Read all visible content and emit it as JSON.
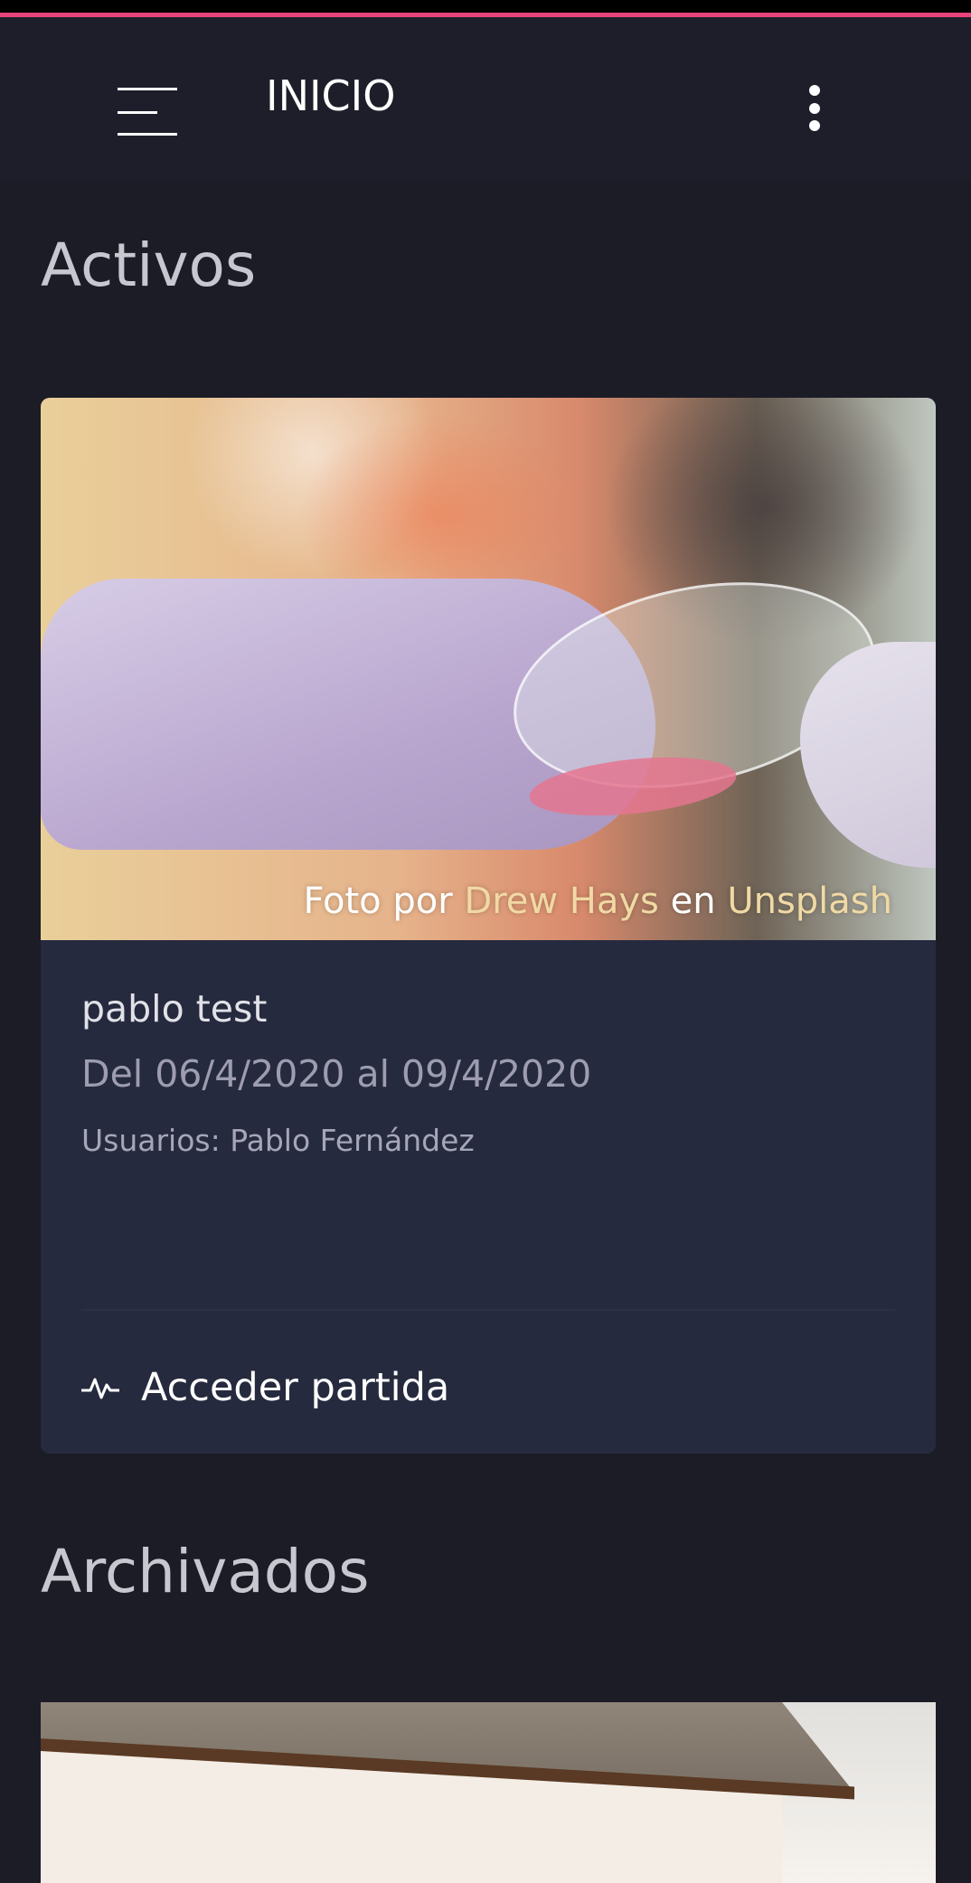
{
  "app": {
    "title": "INICIO",
    "accent": "#e8457a",
    "icons": {
      "menu": "hamburger-icon",
      "more": "kebab-vertical-icon",
      "access": "activity-pulse-icon"
    }
  },
  "sections": {
    "active_title": "Activos",
    "archived_title": "Archivados"
  },
  "active_card": {
    "photo_credit": {
      "prefix": "Foto por",
      "author": "Drew Hays",
      "middle": "en",
      "source": "Unsplash"
    },
    "name": "pablo test",
    "dates": "Del 06/4/2020 al 09/4/2020",
    "users": "Usuarios: Pablo Fernández",
    "action_label": "Acceder partida"
  }
}
